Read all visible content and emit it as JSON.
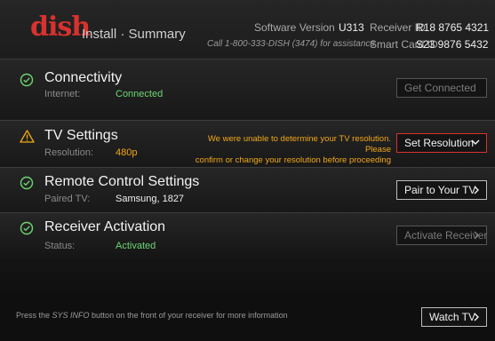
{
  "header": {
    "logo": "dish",
    "title": "Install · Summary",
    "software_version_label": "Software Version",
    "software_version": "U313",
    "receiver_id_label": "Receiver ID",
    "receiver_id": "R18 8765 4321",
    "smart_card_label": "Smart Card ID",
    "smart_card_id": "S23 9876 5432",
    "assistance": "Call 1-800-333-DISH (3474) for assistance"
  },
  "sections": [
    {
      "title": "Connectivity",
      "label": "Internet:",
      "value": "Connected",
      "status": "ok",
      "button": "Get Connected"
    },
    {
      "title": "TV Settings",
      "label": "Resolution:",
      "value": "480p",
      "status": "warning",
      "message_line1": "We were unable to determine your TV resolution. Please",
      "message_line2": "confirm or change your resolution before proceeding",
      "button": "Set Resolution"
    },
    {
      "title": "Remote Control Settings",
      "label": "Paired TV:",
      "value": "Samsung, 1827",
      "status": "ok",
      "button": "Pair to Your TV"
    },
    {
      "title": "Receiver Activation",
      "label": "Status:",
      "value": "Activated",
      "status": "ok",
      "button": "Activate Receiver"
    }
  ],
  "footer": {
    "text_before": "Press the ",
    "text_key": "SYS INFO",
    "text_after": " button on the front of your receiver for more information",
    "button": "Watch TV"
  },
  "colors": {
    "brand": "#d8322e",
    "ok": "#6dd672",
    "warning": "#f2a817"
  }
}
